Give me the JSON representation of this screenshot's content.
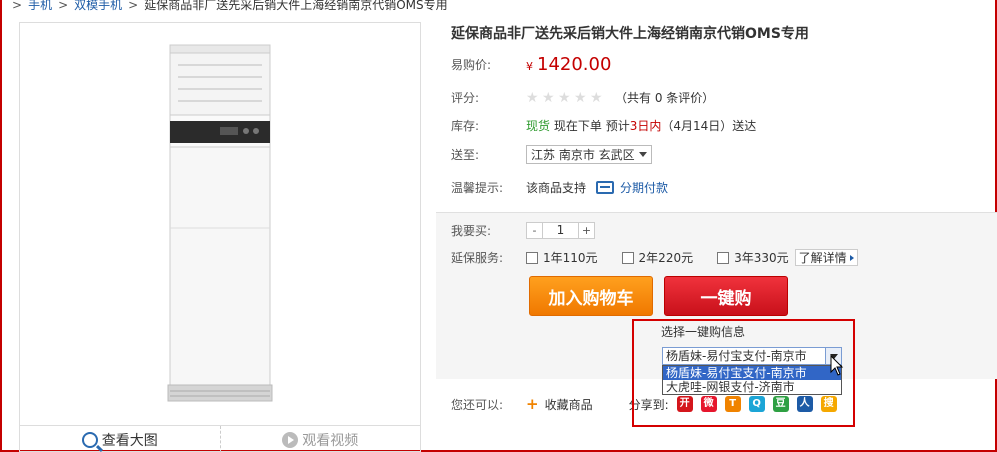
{
  "breadcrumb": {
    "items": [
      "手机",
      "双模手机",
      "延保商品非厂送先采后销大件上海经销南京代销OMS专用"
    ],
    "separator": ">"
  },
  "image_panel": {
    "view_large_label": "查看大图",
    "watch_video_label": "观看视频"
  },
  "product": {
    "title": "延保商品非厂送先采后销大件上海经销南京代销OMS专用",
    "price_label": "易购价:",
    "currency": "¥",
    "price": "1420.00",
    "rating_label": "评分:",
    "rating_stars": 0,
    "rating_text": "（共有 0 条评价）",
    "stock_label": "库存:",
    "stock_status": "现货",
    "stock_order": "现在下单",
    "stock_estimate_prefix": "预计",
    "stock_days": "3日内",
    "stock_date": "（4月14日）送达",
    "ship_label": "送至:",
    "ship_location": "江苏 南京市 玄武区",
    "tip_label": "温馨提示:",
    "tip_text": "该商品支持",
    "installment_label": "分期付款"
  },
  "buy": {
    "qty_label": "我要买:",
    "qty_minus": "-",
    "qty_value": "1",
    "qty_plus": "+",
    "warranty_label": "延保服务:",
    "warranty_options": [
      "1年110元",
      "2年220元",
      "3年330元"
    ],
    "details_label": "了解详情",
    "add_cart_label": "加入购物车",
    "one_click_label": "一键购"
  },
  "one_click_popup": {
    "title": "选择一键购信息",
    "selected": "杨盾妹-易付宝支付-南京市",
    "options": [
      "杨盾妹-易付宝支付-南京市",
      "大虎哇-网银支付-济南市"
    ]
  },
  "share": {
    "you_can_label": "您还可以:",
    "favorite_label": "收藏商品",
    "share_label": "分享到:",
    "icons": [
      {
        "name": "kaixin-icon",
        "glyph": "开",
        "color": "#d4161c"
      },
      {
        "name": "weibo-icon",
        "glyph": "微",
        "color": "#e6162d"
      },
      {
        "name": "tianya-icon",
        "glyph": "T",
        "color": "#f08300"
      },
      {
        "name": "qzone-icon",
        "glyph": "Q",
        "color": "#1ca5d6"
      },
      {
        "name": "douban-icon",
        "glyph": "豆",
        "color": "#2ea043"
      },
      {
        "name": "renren-icon",
        "glyph": "人",
        "color": "#1d5ba6"
      },
      {
        "name": "sohu-icon",
        "glyph": "搜",
        "color": "#f5a800"
      }
    ]
  },
  "colors": {
    "price_red": "#c40000",
    "link_blue": "#1d5ba6",
    "stock_green": "#2e9a2e",
    "cart_orange": "#f07800",
    "buy_red": "#c8101a"
  }
}
